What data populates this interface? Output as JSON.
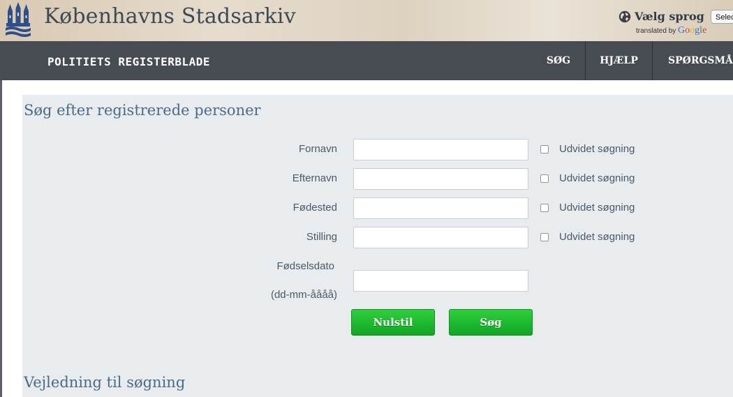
{
  "header": {
    "site_title": "Københavns Stadsarkiv",
    "language_label": "Vælg sprog",
    "translated_by": "translated by",
    "google": [
      "G",
      "o",
      "o",
      "g",
      "l",
      "e"
    ],
    "select_text": "Select",
    "crest_icon": "copenhagen-crest-icon",
    "globe_icon": "globe-icon"
  },
  "navbar": {
    "title": "POLITIETS  REGISTERBLADE",
    "items": [
      {
        "label": "SØG"
      },
      {
        "label": "HJÆLP"
      },
      {
        "label": "SPØRGSMÅL"
      }
    ]
  },
  "search": {
    "heading": "Søg efter registrerede personer",
    "fields": [
      {
        "label": "Fornavn",
        "value": "",
        "extended_label": "Udvidet søgning",
        "extended_checked": false
      },
      {
        "label": "Efternavn",
        "value": "",
        "extended_label": "Udvidet søgning",
        "extended_checked": false
      },
      {
        "label": "Fødested",
        "value": "",
        "extended_label": "Udvidet søgning",
        "extended_checked": false
      },
      {
        "label": "Stilling",
        "value": "",
        "extended_label": "Udvidet søgning",
        "extended_checked": false
      }
    ],
    "birthdate": {
      "label": "Fødselsdato",
      "format_hint": "(dd-mm-åååå)",
      "value": ""
    },
    "reset_button": "Nulstil",
    "search_button": "Søg"
  },
  "guide": {
    "heading": "Vejledning til søgning"
  },
  "colors": {
    "navbar": "#474c53",
    "heading": "#4a6a86",
    "button_green": "#1dbb30",
    "panel": "#e9ecef"
  }
}
